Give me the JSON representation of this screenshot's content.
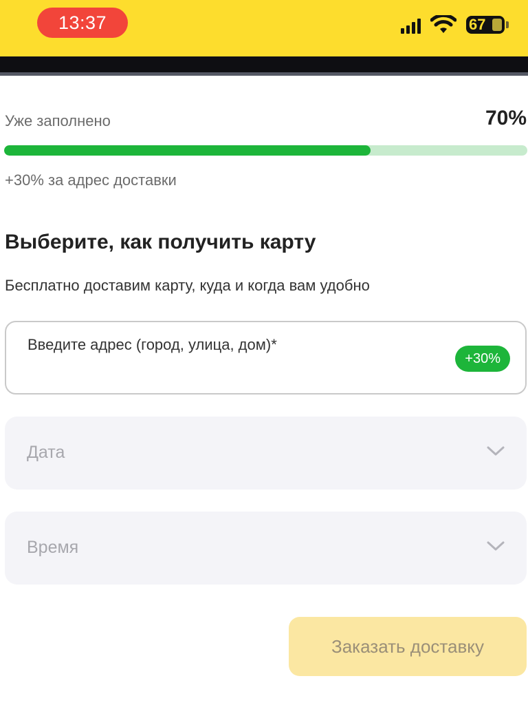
{
  "status_bar": {
    "time": "13:37",
    "battery": "67"
  },
  "progress": {
    "label": "Уже заполнено",
    "percent_text": "70%",
    "value": 0.7,
    "hint": "+30% за адрес доставки"
  },
  "section": {
    "title": "Выберите, как получить карту",
    "subtitle": "Бесплатно доставим карту, куда и когда вам удобно"
  },
  "address": {
    "placeholder": "Введите адрес (город, улица, дом)*",
    "badge": "+30%"
  },
  "date_select": {
    "placeholder": "Дата"
  },
  "time_select": {
    "placeholder": "Время"
  },
  "order_button": {
    "label": "Заказать доставку"
  },
  "colors": {
    "brand_yellow": "#FDDD2D",
    "progress_green": "#1DB53A",
    "progress_track": "#C7EBCD",
    "time_pill": "#F2453A",
    "button_disabled": "#FBE7A2"
  }
}
